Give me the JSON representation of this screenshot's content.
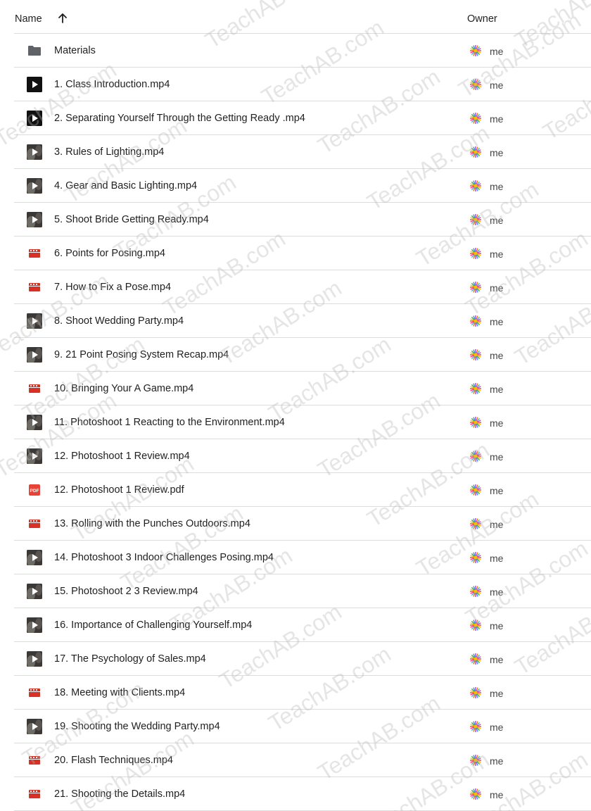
{
  "header": {
    "name_label": "Name",
    "owner_label": "Owner",
    "sort_icon": "arrow-up-icon"
  },
  "colors": {
    "folder": "#5f6368",
    "video_dark": "#111111",
    "video_red": "#d93025",
    "pdf_red": "#ea4335",
    "divider": "#dadce0",
    "text": "#1f1f1f"
  },
  "watermark": "TeachAB.com",
  "files": [
    {
      "name": "Materials",
      "icon": "folder",
      "owner": "me"
    },
    {
      "name": "1. Class Introduction.mp4",
      "icon": "video-play",
      "owner": "me"
    },
    {
      "name": "2. Separating Yourself Through the Getting Ready .mp4",
      "icon": "video-play",
      "owner": "me"
    },
    {
      "name": "3. Rules of Lighting.mp4",
      "icon": "video-thumb",
      "owner": "me"
    },
    {
      "name": "4. Gear and Basic Lighting.mp4",
      "icon": "video-thumb",
      "owner": "me"
    },
    {
      "name": "5. Shoot Bride Getting Ready.mp4",
      "icon": "video-thumb",
      "owner": "me"
    },
    {
      "name": "6. Points for Posing.mp4",
      "icon": "film",
      "owner": "me"
    },
    {
      "name": "7. How to Fix a Pose.mp4",
      "icon": "film",
      "owner": "me"
    },
    {
      "name": "8. Shoot Wedding Party.mp4",
      "icon": "video-thumb",
      "owner": "me"
    },
    {
      "name": "9. 21 Point Posing System Recap.mp4",
      "icon": "video-thumb",
      "owner": "me"
    },
    {
      "name": "10. Bringing Your A Game.mp4",
      "icon": "film",
      "owner": "me"
    },
    {
      "name": "11. Photoshoot 1 Reacting to the Environment.mp4",
      "icon": "video-thumb",
      "owner": "me"
    },
    {
      "name": "12. Photoshoot 1 Review.mp4",
      "icon": "video-thumb",
      "owner": "me"
    },
    {
      "name": "12. Photoshoot 1 Review.pdf",
      "icon": "pdf",
      "owner": "me"
    },
    {
      "name": "13. Rolling with the Punches Outdoors.mp4",
      "icon": "film",
      "owner": "me"
    },
    {
      "name": "14. Photoshoot 3 Indoor Challenges Posing.mp4",
      "icon": "video-thumb",
      "owner": "me"
    },
    {
      "name": "15. Photoshoot 2 3 Review.mp4",
      "icon": "video-thumb",
      "owner": "me"
    },
    {
      "name": "16. Importance of Challenging Yourself.mp4",
      "icon": "video-thumb",
      "owner": "me"
    },
    {
      "name": "17. The Psychology of Sales.mp4",
      "icon": "video-thumb",
      "owner": "me"
    },
    {
      "name": "18. Meeting with Clients.mp4",
      "icon": "film",
      "owner": "me"
    },
    {
      "name": "19. Shooting the Wedding Party.mp4",
      "icon": "video-thumb",
      "owner": "me"
    },
    {
      "name": "20. Flash Techniques.mp4",
      "icon": "film",
      "owner": "me"
    },
    {
      "name": "21. Shooting the Details.mp4",
      "icon": "film",
      "owner": "me"
    }
  ]
}
